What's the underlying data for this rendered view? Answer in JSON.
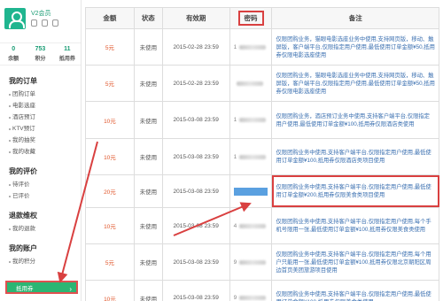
{
  "profile": {
    "level": "V2会员"
  },
  "stats": [
    {
      "value": "0",
      "label": "余额"
    },
    {
      "value": "753",
      "label": "积分"
    },
    {
      "value": "11",
      "label": "抵用券"
    }
  ],
  "nav": {
    "orders_title": "我的订单",
    "orders": [
      "团购订单",
      "电影选座",
      "酒店预订",
      "KTV预订",
      "我的抽奖",
      "我的收藏"
    ],
    "reviews_title": "我的评价",
    "reviews": [
      "待评价",
      "已评价"
    ],
    "refund_title": "退款维权",
    "refunds": [
      "我的退款"
    ],
    "account_title": "我的账户",
    "account": [
      "我的积分"
    ],
    "active_item": "抵用券"
  },
  "table": {
    "headers": [
      "金额",
      "状态",
      "有效期",
      "密码",
      "备注"
    ],
    "rows": [
      {
        "amount": "5元",
        "status": "未使用",
        "expiry": "2015-02-28 23:59",
        "code": "1",
        "note": "仅限团购业务，猫眼电影选座业务中使用,支持网页版，移动、触屏版，客户端平台,仅限指定用户使用,最低使用订单金额¥50,抵用券仅限电影选座使用"
      },
      {
        "amount": "5元",
        "status": "未使用",
        "expiry": "2015-02-28 23:59",
        "code": "",
        "note": "仅限团购业务，猫眼电影选座业务中使用,支持网页版，移动、触屏版，客户端平台,仅限指定用户使用,最低使用订单金额¥50,抵用券仅限电影选座使用"
      },
      {
        "amount": "10元",
        "status": "未使用",
        "expiry": "2015-03-08 23:59",
        "code": "1",
        "note": "仅限团购业务，酒店预订业务中使用,支持客户端平台,仅限指定用户使用,最低使用订单金额¥100,抵用券仅限酒店类使用"
      },
      {
        "amount": "10元",
        "status": "未使用",
        "expiry": "2015-03-08 23:59",
        "code": "1",
        "note": "仅限团购业务中使用,支持客户端平台,仅限指定用户使用,最低使用订单金额¥100,抵用券仅限酒店类项目使用"
      },
      {
        "amount": "20元",
        "status": "未使用",
        "expiry": "2015-03-08 23:59",
        "code": "",
        "note": "仅限团购业务中使用,支持客户端平台,仅限指定用户使用,最低使用订单金额¥200,抵用券仅限美食类项目使用"
      },
      {
        "amount": "10元",
        "status": "未使用",
        "expiry": "2015-03-08 23:59",
        "code": "4",
        "note": "仅限团购业务中使用,支持客户端平台,仅限指定用户使用,每个手机号限用一张,最低使用订单金额¥100,抵用券仅限美食类使用"
      },
      {
        "amount": "5元",
        "status": "未使用",
        "expiry": "2015-03-08 23:59",
        "code": "9",
        "note": "仅限团购业务中使用,支持客户端平台,仅限指定用户使用,每个用户只能用一张,最低使用订单金额¥100,抵用券仅限北京朝阳区周边首页美团旅游项目使用"
      },
      {
        "amount": "10元",
        "status": "未使用",
        "expiry": "2015-03-08 23:59",
        "code": "9",
        "note": "仅限团购业务中使用,支持客户端平台,仅限指定用户使用,最低使用订单金额¥100,抵用券仅限美食类使用"
      }
    ]
  },
  "colors": {
    "accent": "#2bb673",
    "highlight": "#d94040",
    "amount": "#e0572c"
  }
}
